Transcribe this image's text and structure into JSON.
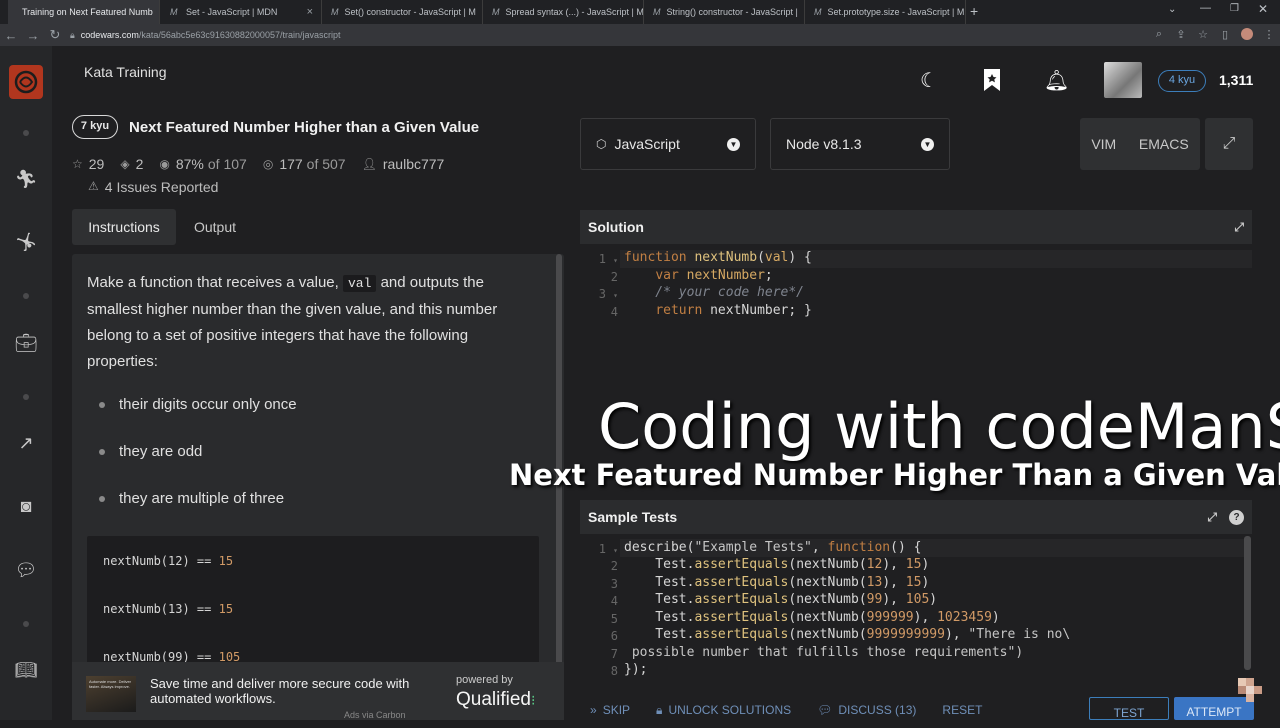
{
  "browser": {
    "tabs": [
      {
        "title": "Training on Next Featured Numb",
        "active": true
      },
      {
        "title": "Set - JavaScript | MDN"
      },
      {
        "title": "Set() constructor - JavaScript | M"
      },
      {
        "title": "Spread syntax (...) - JavaScript | M"
      },
      {
        "title": "String() constructor - JavaScript |"
      },
      {
        "title": "Set.prototype.size - JavaScript | M"
      }
    ],
    "new_tab": "+",
    "url_domain": "codewars.com",
    "url_path": "/kata/56abc5e63c91630882000057/train/javascript"
  },
  "header": {
    "section": "Kata Training",
    "rank": "4 kyu",
    "honor": "1,311"
  },
  "kata": {
    "kyu": "7 kyu",
    "title": "Next Featured Number Higher than a Given Value",
    "stars": "29",
    "collections": "2",
    "satisfaction": "87%",
    "satisfaction_of": "of 107",
    "completed": "177",
    "completed_of": "of 507",
    "author": "raulbc777",
    "issues": "4 Issues Reported"
  },
  "tabs": {
    "instructions": "Instructions",
    "output": "Output"
  },
  "instructions": {
    "p1_before": "Make a function that receives a value,",
    "p1_code": "val",
    "p1_after": "and outputs the smallest higher number than the given value, and this number belong to a set of positive integers that have the following properties:",
    "bullets": [
      "their digits occur only once",
      "they are odd",
      "they are multiple of three"
    ],
    "examples": [
      {
        "call": "nextNumb(12) == ",
        "result": "15"
      },
      {
        "call": "nextNumb(13) == ",
        "result": "15"
      },
      {
        "call": "nextNumb(99) == ",
        "result": "105"
      }
    ]
  },
  "ad": {
    "thumb_text": "Automate more. Deliver faster. Always improve.",
    "text": "Save time and deliver more secure code with automated workflows.",
    "powered": "powered by",
    "brand": "Qualified",
    "via": "Ads via Carbon"
  },
  "editor": {
    "language": "JavaScript",
    "version": "Node v8.1.3",
    "mode_vim": "VIM",
    "mode_emacs": "EMACS",
    "solution_label": "Solution",
    "tests_label": "Sample Tests"
  },
  "overlay": {
    "line1": "Coding with codeManS",
    "line2": "Next Featured Number Higher Than a Given Value"
  },
  "solution_lines": [
    {
      "n": "1",
      "fold": "▾",
      "text": "function nextNumb(val) {"
    },
    {
      "n": "2",
      "text": "    var nextNumber;"
    },
    {
      "n": "3",
      "fold": "▾",
      "text": "    /* your code here*/"
    },
    {
      "n": "4",
      "text": "    return nextNumber; }"
    }
  ],
  "test_lines": [
    {
      "n": "1",
      "fold": "▾",
      "text": "describe(\"Example Tests\", function() {"
    },
    {
      "n": "2",
      "text": "    Test.assertEquals(nextNumb(12), 15)"
    },
    {
      "n": "3",
      "text": "    Test.assertEquals(nextNumb(13), 15)"
    },
    {
      "n": "4",
      "text": "    Test.assertEquals(nextNumb(99), 105)"
    },
    {
      "n": "5",
      "text": "    Test.assertEquals(nextNumb(999999), 1023459)"
    },
    {
      "n": "6",
      "text": "    Test.assertEquals(nextNumb(9999999999), \"There is no\\"
    },
    {
      "n": "7",
      "text": " possible number that fulfills those requirements\")"
    },
    {
      "n": "8",
      "text": "});"
    }
  ],
  "bottom": {
    "skip": "SKIP",
    "unlock": "UNLOCK SOLUTIONS",
    "discuss": "DISCUSS (13)",
    "reset": "RESET",
    "test": "TEST",
    "attempt": "ATTEMPT"
  },
  "colors": {
    "brand": "#b1361e",
    "accent": "#3a75c4"
  }
}
